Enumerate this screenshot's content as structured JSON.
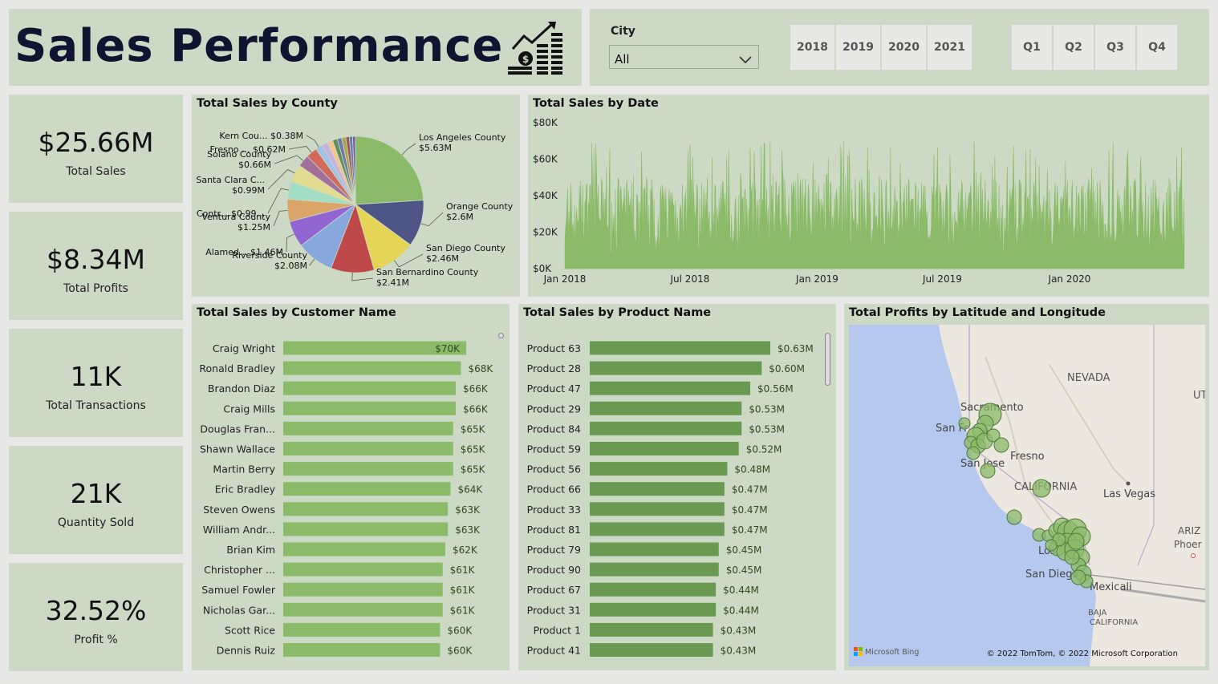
{
  "header": {
    "title": "Sales Performance",
    "icon": "sales-growth-icon"
  },
  "filters": {
    "city_label": "City",
    "city_value": "All",
    "years": [
      "2018",
      "2019",
      "2020",
      "2021"
    ],
    "quarters": [
      "Q1",
      "Q2",
      "Q3",
      "Q4"
    ]
  },
  "kpis": [
    {
      "value": "$25.66M",
      "label": "Total Sales"
    },
    {
      "value": "$8.34M",
      "label": "Total Profits"
    },
    {
      "value": "11K",
      "label": "Total Transactions"
    },
    {
      "value": "21K",
      "label": "Quantity Sold"
    },
    {
      "value": "32.52%",
      "label": "Profit %"
    }
  ],
  "colors": {
    "panel": "#ccd9c4",
    "customer_bar": "#8bbb68",
    "product_bar": "#6a9a52",
    "line_series": "#8bbb68"
  },
  "chart_data": [
    {
      "type": "pie",
      "title": "Total Sales by County",
      "slices": [
        {
          "label": "Los Angeles County",
          "display": "Los Angeles County",
          "value_text": "$5.63M",
          "value": 5.63,
          "color": "#8bbb68"
        },
        {
          "label": "Orange County",
          "display": "Orange County",
          "value_text": "$2.6M",
          "value": 2.6,
          "color": "#4d5486"
        },
        {
          "label": "San Diego County",
          "display": "San Diego County",
          "value_text": "$2.46M",
          "value": 2.46,
          "color": "#e5d456"
        },
        {
          "label": "San Bernardino County",
          "display": "San Bernardino County",
          "value_text": "$2.41M",
          "value": 2.41,
          "color": "#bf4848"
        },
        {
          "label": "Riverside County",
          "display": "Riverside County",
          "value_text": "$2.08M",
          "value": 2.08,
          "color": "#86a8dc"
        },
        {
          "label": "Alameda County",
          "display": "Alamed...",
          "value_text": "$1.46M",
          "value": 1.46,
          "color": "#9166d2"
        },
        {
          "label": "Ventura County",
          "display": "Ventura County",
          "value_text": "$1.25M",
          "value": 1.25,
          "color": "#dba469"
        },
        {
          "label": "Contra Costa County",
          "display": "Contr...",
          "value_text": "$0.99...",
          "value": 0.99,
          "color": "#a3ddc4"
        },
        {
          "label": "Santa Clara County",
          "display": "Santa Clara C...",
          "value_text": "$0.99M",
          "value": 0.99,
          "color": "#e1dc90"
        },
        {
          "label": "Solano County",
          "display": "Solano County",
          "value_text": "$0.66M",
          "value": 0.66,
          "color": "#a16f9a"
        },
        {
          "label": "Fresno County",
          "display": "Fresno ...",
          "value_text": "$0.62M",
          "value": 0.62,
          "color": "#d26a5c"
        },
        {
          "label": "Kern County",
          "display": "Kern Cou...",
          "value_text": "$0.38M",
          "value": 0.38,
          "color": "#9ec3e6"
        },
        {
          "label": "",
          "display": "",
          "value_text": "",
          "value": 0.35,
          "color": "#c7b1e0"
        },
        {
          "label": "",
          "display": "",
          "value_text": "",
          "value": 0.3,
          "color": "#f3c58d"
        },
        {
          "label": "",
          "display": "",
          "value_text": "",
          "value": 0.27,
          "color": "#5e8f63"
        },
        {
          "label": "",
          "display": "",
          "value_text": "",
          "value": 0.25,
          "color": "#6e7aa5"
        },
        {
          "label": "",
          "display": "",
          "value_text": "",
          "value": 0.22,
          "color": "#b0a052"
        },
        {
          "label": "",
          "display": "",
          "value_text": "",
          "value": 0.2,
          "color": "#9c5a5a"
        },
        {
          "label": "",
          "display": "",
          "value_text": "",
          "value": 0.18,
          "color": "#5f7fae"
        },
        {
          "label": "",
          "display": "",
          "value_text": "",
          "value": 0.16,
          "color": "#7c5da8"
        }
      ]
    },
    {
      "type": "area",
      "title": "Total Sales by Date",
      "x_start": "2018-01-01",
      "x_end": "2020-06-15",
      "x_ticks": [
        "Jan 2018",
        "Jul 2018",
        "Jan 2019",
        "Jul 2019",
        "Jan 2020"
      ],
      "y_ticks": [
        "$0K",
        "$20K",
        "$40K",
        "$60K",
        "$80K"
      ],
      "ylim": [
        0,
        80000
      ],
      "series_color": "#8bbb68",
      "typical_range": [
        15000,
        50000
      ],
      "max": 71000
    },
    {
      "type": "bar",
      "title": "Total Sales by Customer Name",
      "orientation": "horizontal",
      "categories": [
        "Craig Wright",
        "Ronald Bradley",
        "Brandon Diaz",
        "Craig Mills",
        "Douglas Fran...",
        "Shawn Wallace",
        "Martin Berry",
        "Eric Bradley",
        "Steven Owens",
        "William Andr...",
        "Brian Kim",
        "Christopher ...",
        "Samuel Fowler",
        "Nicholas Gar...",
        "Scott Rice",
        "Dennis Ruiz"
      ],
      "values": [
        70,
        68,
        66,
        66,
        65,
        65,
        65,
        64,
        63,
        63,
        62,
        61,
        61,
        61,
        60,
        60
      ],
      "labels": [
        "$70K",
        "$68K",
        "$66K",
        "$66K",
        "$65K",
        "$65K",
        "$65K",
        "$64K",
        "$63K",
        "$63K",
        "$62K",
        "$61K",
        "$61K",
        "$61K",
        "$60K",
        "$60K"
      ],
      "unit": "K"
    },
    {
      "type": "bar",
      "title": "Total Sales by Product Name",
      "orientation": "horizontal",
      "categories": [
        "Product 63",
        "Product 28",
        "Product 47",
        "Product 29",
        "Product 84",
        "Product 59",
        "Product 56",
        "Product 66",
        "Product 33",
        "Product 81",
        "Product 79",
        "Product 90",
        "Product 67",
        "Product 31",
        "Product 1",
        "Product 41"
      ],
      "values": [
        0.63,
        0.6,
        0.56,
        0.53,
        0.53,
        0.52,
        0.48,
        0.47,
        0.47,
        0.47,
        0.45,
        0.45,
        0.44,
        0.44,
        0.43,
        0.43
      ],
      "labels": [
        "$0.63M",
        "$0.60M",
        "$0.56M",
        "$0.53M",
        "$0.53M",
        "$0.52M",
        "$0.48M",
        "$0.47M",
        "$0.47M",
        "$0.47M",
        "$0.45M",
        "$0.45M",
        "$0.44M",
        "$0.44M",
        "$0.43M",
        "$0.43M"
      ],
      "unit": "M"
    }
  ],
  "map": {
    "title": "Total Profits by Latitude and Longitude",
    "labels": [
      "NEVADA",
      "UT",
      "Sacramento",
      "San Fr",
      "Fresno",
      "San Jose",
      "CALIFORNIA",
      "Las Vegas",
      "ARIZ",
      "Phoer",
      "Los",
      "San Diego",
      "Mexicali",
      "BAJA",
      "CALIFORNIA"
    ],
    "credit_left": "Microsoft Bing",
    "credit_right": "© 2022 TomTom, © 2022 Microsoft Corporation"
  }
}
